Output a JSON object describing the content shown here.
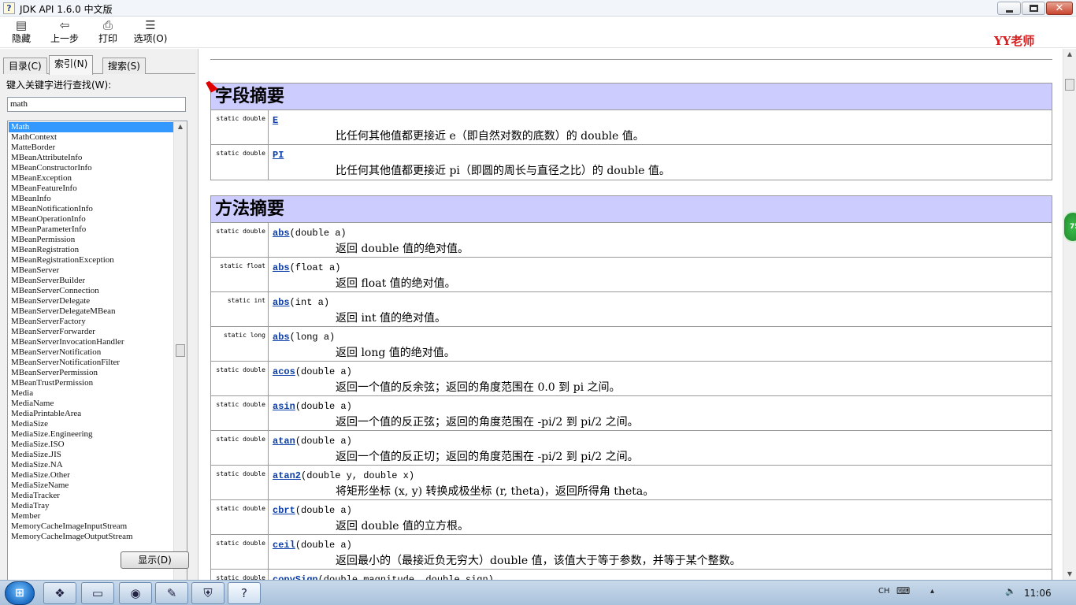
{
  "window": {
    "title": "JDK API 1.6.0 中文版",
    "icon_glyph": "?"
  },
  "watermark": "YY老师",
  "toolbar": [
    {
      "name": "hide",
      "label": "隐藏",
      "icon": "hide-icon",
      "glyph": "▤"
    },
    {
      "name": "back",
      "label": "上一步",
      "icon": "back-arrow-icon",
      "glyph": "⇦"
    },
    {
      "name": "print",
      "label": "打印",
      "icon": "printer-icon",
      "glyph": "⎙"
    },
    {
      "name": "options",
      "label": "选项(O)",
      "icon": "options-icon",
      "glyph": "☰"
    }
  ],
  "tabs": [
    {
      "label": "目录(C)",
      "active": false
    },
    {
      "label": "索引(N)",
      "active": true
    },
    {
      "label": "搜索(S)",
      "active": false
    }
  ],
  "search": {
    "label": "键入关键字进行查找(W):",
    "value": "math"
  },
  "index_list": {
    "selected": "Math",
    "items": [
      "Math",
      "MathContext",
      "MatteBorder",
      "MBeanAttributeInfo",
      "MBeanConstructorInfo",
      "MBeanException",
      "MBeanFeatureInfo",
      "MBeanInfo",
      "MBeanNotificationInfo",
      "MBeanOperationInfo",
      "MBeanParameterInfo",
      "MBeanPermission",
      "MBeanRegistration",
      "MBeanRegistrationException",
      "MBeanServer",
      "MBeanServerBuilder",
      "MBeanServerConnection",
      "MBeanServerDelegate",
      "MBeanServerDelegateMBean",
      "MBeanServerFactory",
      "MBeanServerForwarder",
      "MBeanServerInvocationHandler",
      "MBeanServerNotification",
      "MBeanServerNotificationFilter",
      "MBeanServerPermission",
      "MBeanTrustPermission",
      "Media",
      "MediaName",
      "MediaPrintableArea",
      "MediaSize",
      "MediaSize.Engineering",
      "MediaSize.ISO",
      "MediaSize.JIS",
      "MediaSize.NA",
      "MediaSize.Other",
      "MediaSizeName",
      "MediaTracker",
      "MediaTray",
      "Member",
      "MemoryCacheImageInputStream",
      "MemoryCacheImageOutputStream"
    ]
  },
  "show_button": "显示(D)",
  "field_summary": {
    "title": "字段摘要",
    "rows": [
      {
        "modifier": "static double",
        "name": "E",
        "params": "",
        "desc": "比任何其他值都更接近 e（即自然对数的底数）的 double 值。"
      },
      {
        "modifier": "static double",
        "name": "PI",
        "params": "",
        "desc": "比任何其他值都更接近 pi（即圆的周长与直径之比）的 double 值。"
      }
    ]
  },
  "method_summary": {
    "title": "方法摘要",
    "rows": [
      {
        "modifier": "static double",
        "name": "abs",
        "params": "(double a)",
        "desc": "返回 double 值的绝对值。"
      },
      {
        "modifier": "static float",
        "name": "abs",
        "params": "(float a)",
        "desc": "返回 float 值的绝对值。"
      },
      {
        "modifier": "static int",
        "name": "abs",
        "params": "(int a)",
        "desc": "返回 int 值的绝对值。"
      },
      {
        "modifier": "static long",
        "name": "abs",
        "params": "(long a)",
        "desc": "返回 long 值的绝对值。"
      },
      {
        "modifier": "static double",
        "name": "acos",
        "params": "(double a)",
        "desc": "返回一个值的反余弦；返回的角度范围在 0.0 到 pi 之间。"
      },
      {
        "modifier": "static double",
        "name": "asin",
        "params": "(double a)",
        "desc": "返回一个值的反正弦；返回的角度范围在 -pi/2 到 pi/2 之间。"
      },
      {
        "modifier": "static double",
        "name": "atan",
        "params": "(double a)",
        "desc": "返回一个值的反正切；返回的角度范围在 -pi/2 到 pi/2 之间。"
      },
      {
        "modifier": "static double",
        "name": "atan2",
        "params": "(double y, double x)",
        "desc": "将矩形坐标 (x, y) 转换成极坐标 (r, theta)，返回所得角 theta。"
      },
      {
        "modifier": "static double",
        "name": "cbrt",
        "params": "(double a)",
        "desc": "返回 double 值的立方根。"
      },
      {
        "modifier": "static double",
        "name": "ceil",
        "params": "(double a)",
        "desc": "返回最小的（最接近负无穷大）double 值，该值大于等于参数，并等于某个整数。"
      },
      {
        "modifier": "static double",
        "name": "copySign",
        "params": "(double magnitude, double sign)",
        "desc": ""
      }
    ]
  },
  "badge": "75",
  "taskbar": {
    "start_glyph": "⊞",
    "apps": [
      {
        "name": "apps-icon",
        "glyph": "❖"
      },
      {
        "name": "explorer-icon",
        "glyph": "▭"
      },
      {
        "name": "chrome-icon",
        "glyph": "◉"
      },
      {
        "name": "editor-icon",
        "glyph": "✎"
      },
      {
        "name": "shield-icon",
        "glyph": "⛨"
      },
      {
        "name": "help-icon",
        "glyph": "?"
      }
    ],
    "tray": {
      "lang": "CH",
      "keyboard": "⌨",
      "arrow": "▴",
      "speaker": "🔈"
    },
    "time": "11:06"
  },
  "colors": {
    "header_bg": "#ccccff",
    "link": "#0b3ea8",
    "selection": "#3399ff",
    "watermark": "#d42020"
  }
}
